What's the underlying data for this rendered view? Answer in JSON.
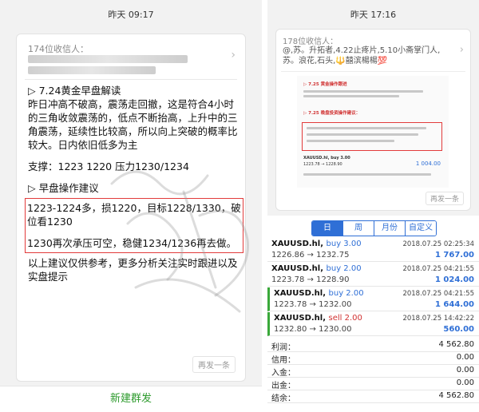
{
  "left": {
    "time": "昨天 09:17",
    "recipients": "174位收信人：",
    "title": "▷ 7.24黄金早盘解读",
    "analysis": "昨日冲高不破高，震荡走回撤，这是符合4小时的三角收敛震荡的，低点不断抬高，上升中的三角震荡，延续性比较高，所以向上突破的概率比较大。日内依旧低多为主",
    "support": "支撑：1223 1220  压力1230/1234",
    "section2": "▷ 早盘操作建议",
    "op1": "1223-1224多，损1220，目标1228/1330，破位看1230",
    "op2": "1230再次承压可空，稳健1234/1236再去做。",
    "disclaimer": "以上建议仅供参考，更多分析关注实时跟进以及实盘提示",
    "resend": "再发一条",
    "new_group": "新建群发"
  },
  "right_top": {
    "time": "昨天 17:16",
    "recipients": "178位收信人：",
    "names": "@,苏。升拓者,4.22止疼片,5.10小斋掌门人,苏。浪花,石头,🔱囍滨楊楊💯",
    "thumb_h1": "▷ 7.25 黄金操作跟进",
    "thumb_h2": "▷ 7.25 晚盘投资操作建议：",
    "thumb_row1_sym": "XAUUSD.hl, buy 3.00",
    "thumb_row1_px": "1223.78 → 1228.90",
    "thumb_row1_pl": "1 004.00",
    "resend": "再发一条"
  },
  "right_bottom": {
    "tabs": [
      "日",
      "周",
      "月份",
      "自定义"
    ],
    "trades": [
      {
        "symbol": "XAUUSD.hl,",
        "side": "buy 3.00",
        "side_type": "buy",
        "prices": "1226.86 → 1232.75",
        "time": "2018.07.25 02:25:34",
        "profit": "1 767.00",
        "highlight": false
      },
      {
        "symbol": "XAUUSD.hl,",
        "side": "buy 2.00",
        "side_type": "buy",
        "prices": "1223.78 → 1228.90",
        "time": "2018.07.25 04:21:55",
        "profit": "1 024.00",
        "highlight": false
      },
      {
        "symbol": "XAUUSD.hl,",
        "side": "buy 2.00",
        "side_type": "buy",
        "prices": "1223.78 → 1232.00",
        "time": "2018.07.25 04:21:55",
        "profit": "1 644.00",
        "highlight": true
      },
      {
        "symbol": "XAUUSD.hl,",
        "side": "sell 2.00",
        "side_type": "sell",
        "prices": "1232.80 → 1230.00",
        "time": "2018.07.25 14:42:22",
        "profit": "560.00",
        "highlight": true
      }
    ],
    "summary": [
      {
        "label": "利润：",
        "value": "4 562.80"
      },
      {
        "label": "信用：",
        "value": "0.00"
      },
      {
        "label": "入金：",
        "value": "0.00"
      },
      {
        "label": "出金：",
        "value": "0.00"
      },
      {
        "label": "结余：",
        "value": "4 562.80"
      }
    ]
  },
  "colors": {
    "accent_blue": "#2f6fd6",
    "alert_red": "#e23b3b",
    "green": "#2e9b2e"
  }
}
